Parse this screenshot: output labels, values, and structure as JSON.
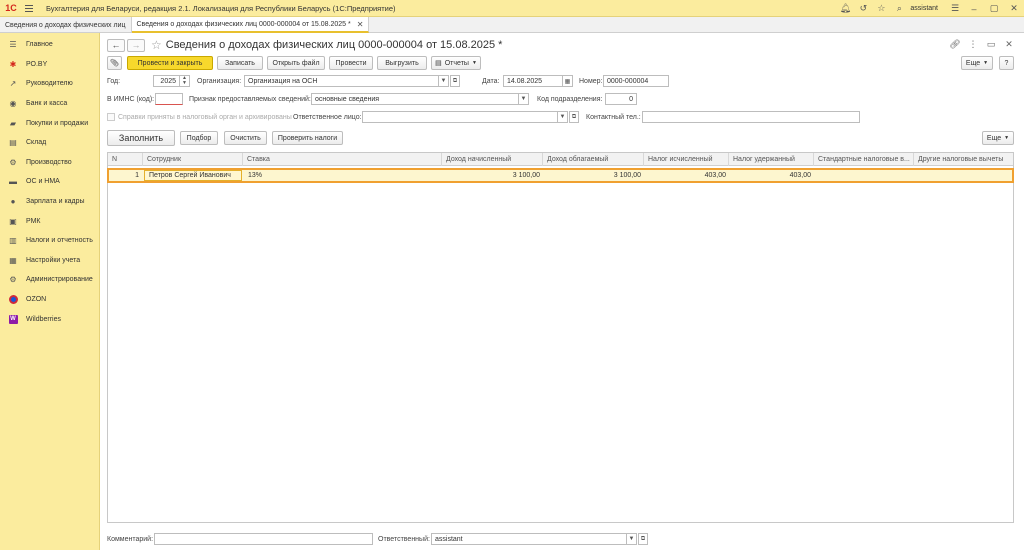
{
  "topbar": {
    "logo": "1С",
    "app_title": "Бухгалтерия для Беларуси, редакция 2.1. Локализация для Республики Беларусь  (1С:Предприятие)",
    "user": "assistant"
  },
  "tabs": [
    {
      "label": "Сведения о доходах физических лиц"
    },
    {
      "label": "Сведения о доходах физических лиц 0000-000004 от 15.08.2025 *"
    }
  ],
  "sidebar": {
    "items": [
      {
        "label": "Главное",
        "icon": "☰"
      },
      {
        "label": "РО.BY",
        "icon": "✱"
      },
      {
        "label": "Руководителю",
        "icon": "↗"
      },
      {
        "label": "Банк и касса",
        "icon": "◉"
      },
      {
        "label": "Покупки и продажи",
        "icon": "▰"
      },
      {
        "label": "Склад",
        "icon": "▤"
      },
      {
        "label": "Производство",
        "icon": "⚙"
      },
      {
        "label": "ОС и НМА",
        "icon": "▬"
      },
      {
        "label": "Зарплата и кадры",
        "icon": "●"
      },
      {
        "label": "РМК",
        "icon": "▣"
      },
      {
        "label": "Налоги и отчетность",
        "icon": "▥"
      },
      {
        "label": "Настройки учета",
        "icon": "▦"
      },
      {
        "label": "Администрирование",
        "icon": "⚙"
      },
      {
        "label": "OZON",
        "icon": "ozon"
      },
      {
        "label": "Wildberries",
        "icon": "W"
      }
    ]
  },
  "document": {
    "title": "Сведения о доходах физических лиц 0000-000004 от 15.08.2025 *"
  },
  "toolbar": {
    "post_close": "Провести и закрыть",
    "save": "Записать",
    "open_file": "Открыть файл",
    "post": "Провести",
    "export": "Выгрузить",
    "reports": "Отчеты",
    "more": "Еще",
    "help": "?"
  },
  "form": {
    "year_label": "Год:",
    "year_value": "2025",
    "org_label": "Организация:",
    "org_value": "Организация на ОСН",
    "date_label": "Дата:",
    "date_value": "14.08.2025",
    "number_label": "Номер:",
    "number_value": "0000-000004",
    "imns_label": "В ИМНС (код):",
    "imns_value": "",
    "sign_label": "Признак предоставляемых сведений:",
    "sign_value": "основные сведения",
    "dept_label": "Код подразделения:",
    "dept_value": "0",
    "archived_label": "Справки приняты в налоговый орган и архивированы",
    "resp_label": "Ответственное лицо:",
    "resp_value": "",
    "contact_label": "Контактный тел.:",
    "contact_value": ""
  },
  "table_toolbar": {
    "fill": "Заполнить",
    "select": "Подбор",
    "clear": "Очистить",
    "check": "Проверить налоги",
    "more": "Еще"
  },
  "table": {
    "columns": [
      "N",
      "Сотрудник",
      "Ставка",
      "Доход начисленный",
      "Доход облагаемый",
      "Налог исчисленный",
      "Налог удержанный",
      "Стандартные налоговые в...",
      "Другие налоговые вычеты"
    ],
    "rows": [
      {
        "n": "1",
        "employee": "Петров Сергей Иванович",
        "rate": "13%",
        "income_accrued": "3 100,00",
        "income_taxable": "3 100,00",
        "tax_calc": "403,00",
        "tax_withheld": "403,00",
        "std": "",
        "other": ""
      }
    ]
  },
  "footer": {
    "comment_label": "Комментарий:",
    "comment_value": "",
    "responsible_label": "Ответственный:",
    "responsible_value": "assistant"
  },
  "colors": {
    "accent_yellow": "#fbec9e",
    "button_yellow": "#f7d82c",
    "selection_orange": "#f0a030"
  }
}
